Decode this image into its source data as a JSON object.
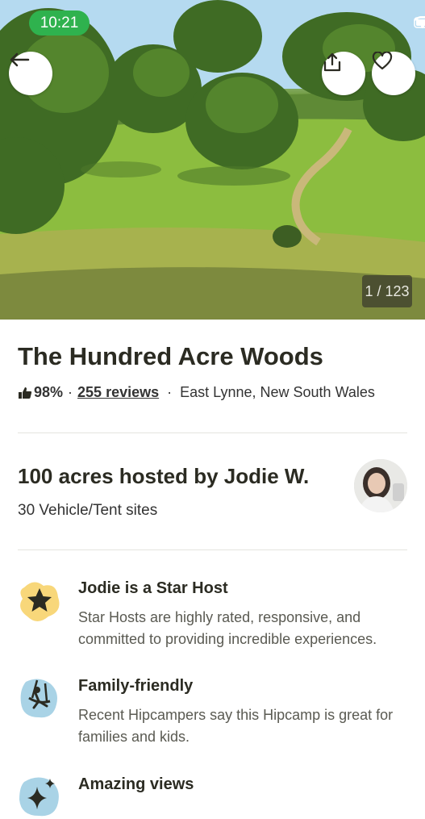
{
  "status_bar": {
    "time": "10:21"
  },
  "gallery": {
    "counter": "1 / 123"
  },
  "listing": {
    "title": "The Hundred Acre Woods",
    "rating_percent": "98%",
    "separator": "·",
    "reviews_link": "255 reviews",
    "location": "East Lynne, New South Wales"
  },
  "host": {
    "headline": "100 acres hosted by Jodie W.",
    "sites": "30 Vehicle/Tent sites"
  },
  "features": [
    {
      "title": "Jodie is a Star Host",
      "description": "Star Hosts are highly rated, responsive, and committed to providing incredible experiences.",
      "icon": "star-icon",
      "color": "#f8d77a"
    },
    {
      "title": "Family-friendly",
      "description": "Recent Hipcampers say this Hipcamp is great for families and kids.",
      "icon": "swing-icon",
      "color": "#a9d3e6"
    },
    {
      "title": "Amazing views",
      "description": "",
      "icon": "sparkle-icon",
      "color": "#a9d3e6"
    }
  ],
  "icons": {
    "back": "arrow-left-icon",
    "share": "share-icon",
    "favorite": "heart-icon",
    "thumbs_up": "thumbs-up-icon"
  }
}
